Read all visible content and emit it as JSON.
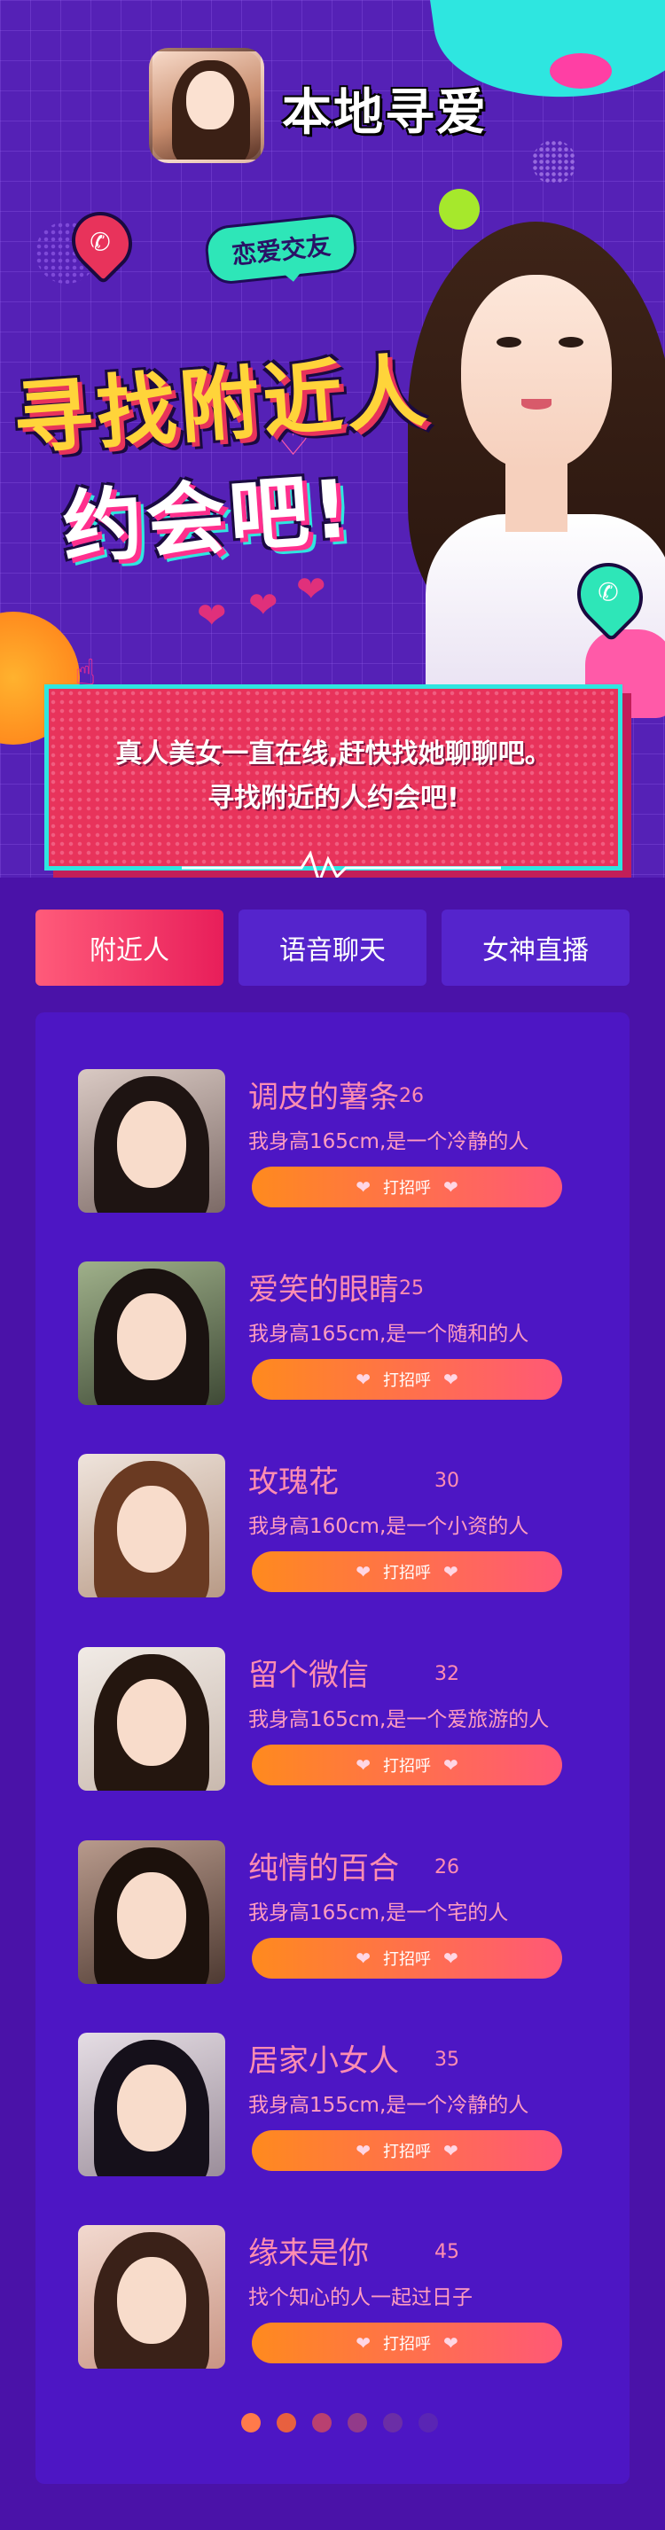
{
  "app": {
    "name": "本地寻爱"
  },
  "hero": {
    "tag": "恋爱交友",
    "headline_line1": "寻找附近人",
    "headline_line2": "约会吧!"
  },
  "banner": {
    "line1": "真人美女一直在线,赶快找她聊聊吧。",
    "line2": "寻找附近的人约会吧!"
  },
  "tabs": [
    {
      "label": "附近人",
      "active": true
    },
    {
      "label": "语音聊天",
      "active": false
    },
    {
      "label": "女神直播",
      "active": false
    }
  ],
  "profiles": [
    {
      "name": "调皮的薯条",
      "age": "26",
      "desc": "我身高165cm,是一个冷静的人",
      "button": "打招呼"
    },
    {
      "name": "爱笑的眼睛",
      "age": "25",
      "desc": "我身高165cm,是一个随和的人",
      "button": "打招呼"
    },
    {
      "name": "玫瑰花",
      "age": "30",
      "desc": "我身高160cm,是一个小资的人",
      "button": "打招呼"
    },
    {
      "name": "留个微信",
      "age": "32",
      "desc": "我身高165cm,是一个爱旅游的人",
      "button": "打招呼"
    },
    {
      "name": "纯情的百合",
      "age": "26",
      "desc": "我身高165cm,是一个宅的人",
      "button": "打招呼"
    },
    {
      "name": "居家小女人",
      "age": "35",
      "desc": "我身高155cm,是一个冷静的人",
      "button": "打招呼"
    },
    {
      "name": "缘来是你",
      "age": "45",
      "desc": "找个知心的人一起过日子",
      "button": "打招呼"
    }
  ],
  "pagination": {
    "total": 6,
    "current": 1
  },
  "colors": {
    "background": "#4a12a8",
    "accent_pink": "#e8335b",
    "accent_cyan": "#2ee6e0",
    "name_pink": "#ff8db1",
    "button_orange": "#ff8a1e"
  }
}
